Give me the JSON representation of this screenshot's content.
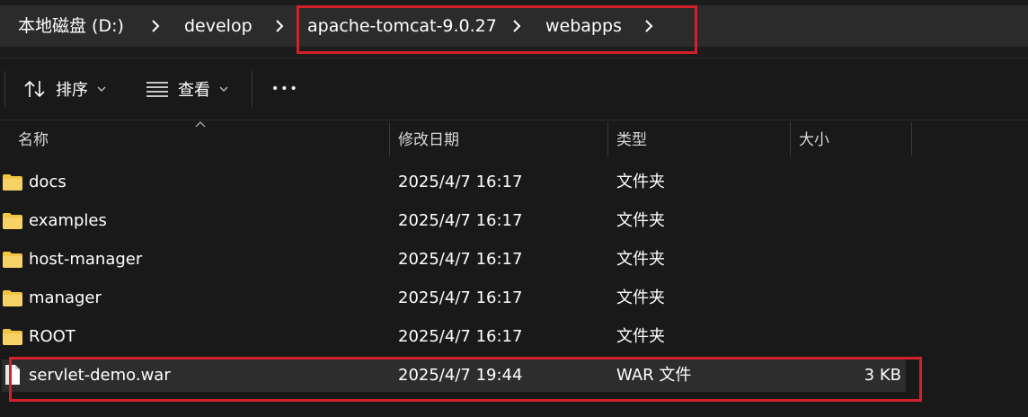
{
  "breadcrumb": {
    "items": [
      {
        "label": "本地磁盘 (D:)"
      },
      {
        "label": "develop"
      },
      {
        "label": "apache-tomcat-9.0.27"
      },
      {
        "label": "webapps"
      }
    ]
  },
  "toolbar": {
    "sort_label": "排序",
    "view_label": "查看",
    "more_label": "•••"
  },
  "columns": {
    "name": "名称",
    "date": "修改日期",
    "type": "类型",
    "size": "大小"
  },
  "files": [
    {
      "name": "docs",
      "date": "2025/4/7 16:17",
      "type": "文件夹",
      "size": "",
      "icon": "folder-icon"
    },
    {
      "name": "examples",
      "date": "2025/4/7 16:17",
      "type": "文件夹",
      "size": "",
      "icon": "folder-icon"
    },
    {
      "name": "host-manager",
      "date": "2025/4/7 16:17",
      "type": "文件夹",
      "size": "",
      "icon": "folder-icon"
    },
    {
      "name": "manager",
      "date": "2025/4/7 16:17",
      "type": "文件夹",
      "size": "",
      "icon": "folder-icon"
    },
    {
      "name": "ROOT",
      "date": "2025/4/7 16:17",
      "type": "文件夹",
      "size": "",
      "icon": "folder-icon"
    },
    {
      "name": "servlet-demo.war",
      "date": "2025/4/7 19:44",
      "type": "WAR 文件",
      "size": "3 KB",
      "icon": "file-icon"
    }
  ],
  "colors": {
    "highlight": "#d4202a",
    "folder": "#f3c43f",
    "background": "#191919"
  }
}
